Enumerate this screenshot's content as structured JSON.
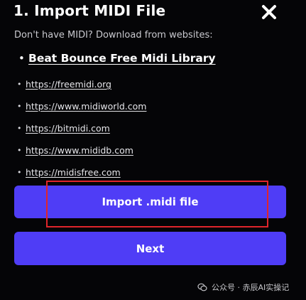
{
  "dialog": {
    "title": "1. Import MIDI File",
    "close_icon": "close-icon",
    "subtitle": "Don't have MIDI? Download from websites:",
    "featured_link": "Beat Bounce Free Midi Library",
    "links": [
      "https://freemidi.org",
      "https://www.midiworld.com",
      "https://bitmidi.com",
      "https://www.mididb.com",
      "https://midisfree.com"
    ],
    "bullet": "•",
    "import_button_label": "Import .midi file",
    "next_button_label": "Next"
  },
  "watermark": {
    "text": "公众号 · 赤辰AI实操记",
    "icon": "wechat-icon"
  },
  "colors": {
    "background": "#050507",
    "button": "#4f3df6",
    "highlight": "#e0252b",
    "text": "#ffffff"
  }
}
